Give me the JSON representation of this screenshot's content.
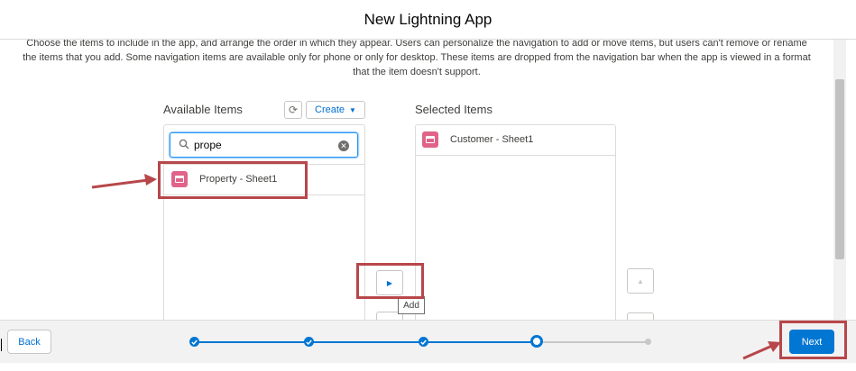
{
  "header": {
    "title": "New Lightning App"
  },
  "description": "Choose the items to include in the app, and arrange the order in which they appear. Users can personalize the navigation to add or move items, but users can't remove or rename the items that you add. Some navigation items are available only for phone or only for desktop. These items are dropped from the navigation bar when the app is viewed in a format that the item doesn't support.",
  "available": {
    "label": "Available Items",
    "create_label": "Create",
    "search_value": "prope",
    "items": [
      {
        "label": "Property - Sheet1"
      }
    ]
  },
  "selected": {
    "label": "Selected Items",
    "items": [
      {
        "label": "Customer - Sheet1"
      }
    ]
  },
  "move": {
    "add_tooltip": "Add"
  },
  "footer": {
    "back_label": "Back",
    "next_label": "Next",
    "progress": {
      "total_steps": 5,
      "current_step": 4,
      "completed_steps": 3
    }
  },
  "colors": {
    "brand": "#0176d3",
    "object_icon": "#e06489",
    "annotation": "#b7474a"
  },
  "icons": {
    "refresh": "refresh-icon",
    "search": "search-icon",
    "clear": "clear-icon",
    "object": "archive-icon",
    "move_right": "right-triangle-icon",
    "move_up": "up-triangle-icon"
  }
}
